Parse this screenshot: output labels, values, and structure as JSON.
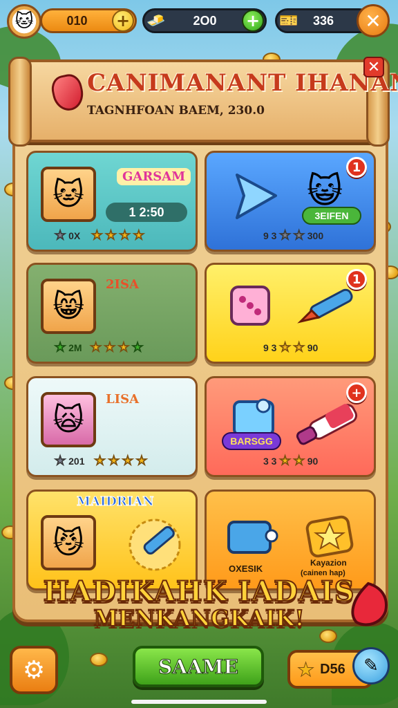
{
  "hud": {
    "coins": "010",
    "gems": "2O0",
    "tokens": "336",
    "coins_plus": "+",
    "gems_plus": "+",
    "close": "✕"
  },
  "banner": {
    "title": "CANIMANANT IHANAN",
    "subtitle": "TAGNHFOAN BAEM, 230.0",
    "close": "✕"
  },
  "cards": [
    {
      "name": "GARSAM",
      "timer": "1 2:50",
      "count": "0X"
    },
    {
      "tag": "3EIFEN",
      "price_left": "9 3",
      "price_right": "300",
      "badge": "1"
    },
    {
      "name": "2ISA",
      "count": "2M"
    },
    {
      "price_left": "9 3",
      "price_right": "90",
      "badge": "1"
    },
    {
      "name": "LISA",
      "count": "201"
    },
    {
      "tag": "BARSGG",
      "price_left": "3 3",
      "price_right": "90",
      "badge": "+"
    },
    {
      "name": "MAIDRIAN"
    },
    {
      "label_left": "OXESIK",
      "label_right_1": "Kayazion",
      "label_right_2": "(cainen hap)"
    }
  ],
  "promo": {
    "line1": "HADIKAHK IADAIS",
    "line2": "MENKANGKAIK!"
  },
  "bottom": {
    "main_button": "SAAME",
    "right_value": "D56"
  },
  "colors": {
    "card_teal": "#5fc9c9",
    "card_blue": "#4a8ff0",
    "card_green": "#7aa86a",
    "card_yellow": "#ffd93a",
    "card_light": "#dff1f1",
    "card_coral": "#ff8a6a",
    "card_gold": "#ffd24a",
    "card_orange": "#ffb23a"
  }
}
